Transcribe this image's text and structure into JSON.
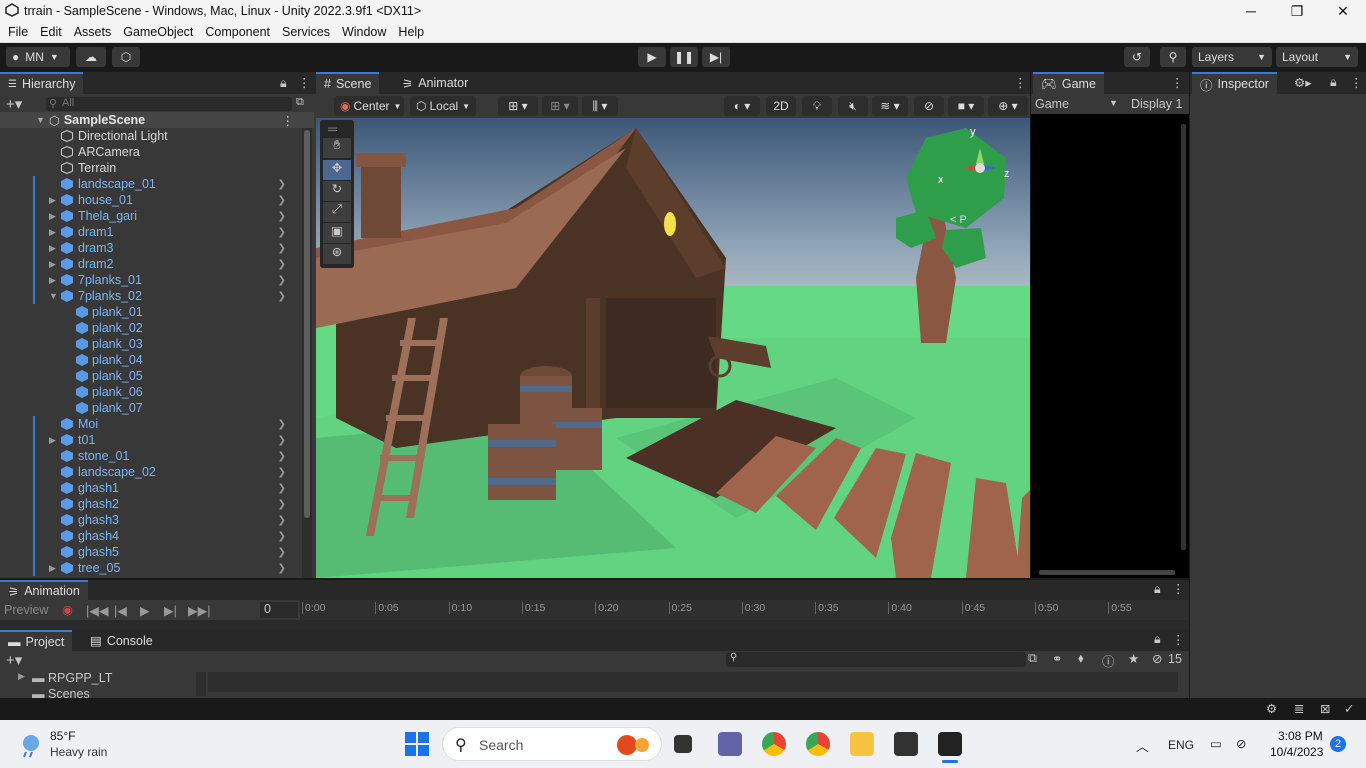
{
  "window": {
    "title": "trrain - SampleScene - Windows, Mac, Linux - Unity 2022.3.9f1 <DX11>",
    "minimize": "─",
    "maximize": "❐",
    "close": "✕"
  },
  "menu": [
    "File",
    "Edit",
    "Assets",
    "GameObject",
    "Component",
    "Services",
    "Window",
    "Help"
  ],
  "toolbar": {
    "account": "MN",
    "layers": "Layers",
    "layout": "Layout"
  },
  "hierarchy": {
    "tab": "Hierarchy",
    "search_placeholder": "All",
    "scene": "SampleScene",
    "items": [
      {
        "label": "Directional Light",
        "style": "white",
        "indent": 0,
        "expander": "",
        "arrow": false
      },
      {
        "label": "ARCamera",
        "style": "white",
        "indent": 0,
        "expander": "",
        "arrow": false
      },
      {
        "label": "Terrain",
        "style": "white",
        "indent": 0,
        "expander": "",
        "arrow": false
      },
      {
        "label": "landscape_01",
        "style": "blue",
        "indent": 0,
        "expander": "",
        "arrow": true
      },
      {
        "label": "house_01",
        "style": "blue",
        "indent": 0,
        "expander": "▶",
        "arrow": true
      },
      {
        "label": "Thela_gari",
        "style": "blue",
        "indent": 0,
        "expander": "▶",
        "arrow": true
      },
      {
        "label": "dram1",
        "style": "blue",
        "indent": 0,
        "expander": "▶",
        "arrow": true
      },
      {
        "label": "dram3",
        "style": "blue",
        "indent": 0,
        "expander": "▶",
        "arrow": true
      },
      {
        "label": "dram2",
        "style": "blue",
        "indent": 0,
        "expander": "▶",
        "arrow": true
      },
      {
        "label": "7planks_01",
        "style": "blue",
        "indent": 0,
        "expander": "▶",
        "arrow": true
      },
      {
        "label": "7planks_02",
        "style": "blue",
        "indent": 0,
        "expander": "▼",
        "arrow": true
      },
      {
        "label": "plank_01",
        "style": "blue",
        "indent": 1,
        "expander": "",
        "arrow": false
      },
      {
        "label": "plank_02",
        "style": "blue",
        "indent": 1,
        "expander": "",
        "arrow": false
      },
      {
        "label": "plank_03",
        "style": "blue",
        "indent": 1,
        "expander": "",
        "arrow": false
      },
      {
        "label": "plank_04",
        "style": "blue",
        "indent": 1,
        "expander": "",
        "arrow": false
      },
      {
        "label": "plank_05",
        "style": "blue",
        "indent": 1,
        "expander": "",
        "arrow": false
      },
      {
        "label": "plank_06",
        "style": "blue",
        "indent": 1,
        "expander": "",
        "arrow": false
      },
      {
        "label": "plank_07",
        "style": "blue",
        "indent": 1,
        "expander": "",
        "arrow": false
      },
      {
        "label": "Moi",
        "style": "blue",
        "indent": 0,
        "expander": "",
        "arrow": true
      },
      {
        "label": "t01",
        "style": "blue",
        "indent": 0,
        "expander": "▶",
        "arrow": true
      },
      {
        "label": "stone_01",
        "style": "blue",
        "indent": 0,
        "expander": "",
        "arrow": true
      },
      {
        "label": "landscape_02",
        "style": "blue",
        "indent": 0,
        "expander": "",
        "arrow": true
      },
      {
        "label": "ghash1",
        "style": "blue",
        "indent": 0,
        "expander": "",
        "arrow": true
      },
      {
        "label": "ghash2",
        "style": "blue",
        "indent": 0,
        "expander": "",
        "arrow": true
      },
      {
        "label": "ghash3",
        "style": "blue",
        "indent": 0,
        "expander": "",
        "arrow": true
      },
      {
        "label": "ghash4",
        "style": "blue",
        "indent": 0,
        "expander": "",
        "arrow": true
      },
      {
        "label": "ghash5",
        "style": "blue",
        "indent": 0,
        "expander": "",
        "arrow": true
      },
      {
        "label": "tree_05",
        "style": "blue",
        "indent": 0,
        "expander": "▶",
        "arrow": true
      }
    ]
  },
  "scene": {
    "tabs": [
      "Scene",
      "Animator"
    ],
    "pivot": "Center",
    "space": "Local",
    "mode_2d": "2D",
    "gizmo_axes": {
      "y": "y",
      "x": "x",
      "z": "z"
    },
    "persp": "< P"
  },
  "game": {
    "tab": "Game",
    "view": "Game",
    "display": "Display 1"
  },
  "inspector": {
    "tab": "Inspector"
  },
  "animation": {
    "tab": "Animation",
    "preview": "Preview",
    "frame": "0",
    "timeline": [
      "0:00",
      "0:05",
      "0:10",
      "0:15",
      "0:20",
      "0:25",
      "0:30",
      "0:35",
      "0:40",
      "0:45",
      "0:50",
      "0:55"
    ]
  },
  "project": {
    "tabs": [
      "Project",
      "Console"
    ],
    "folders": [
      "RPGPP_LT",
      "Scenes"
    ],
    "hidden_count": "15"
  },
  "taskbar": {
    "temp": "85°F",
    "weather": "Heavy rain",
    "search": "Search",
    "lang": "ENG",
    "time": "3:08 PM",
    "date": "10/4/2023",
    "notif": "2"
  }
}
